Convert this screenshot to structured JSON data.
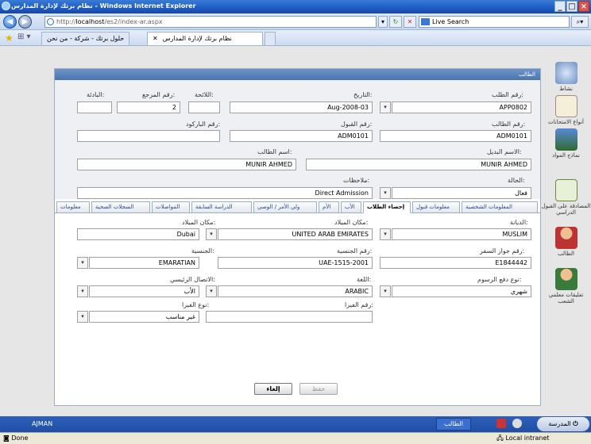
{
  "window": {
    "title": "نظام برتك لإدارة المدارس - Windows Internet Explorer",
    "min": "_",
    "max": "□",
    "close": "×"
  },
  "address": {
    "url_prefix": "http://",
    "url_host": "localhost",
    "url_path": "/es2/index-ar.aspx",
    "search_placeholder": "Live Search"
  },
  "tabs": {
    "tab1": "حلول برتك - شركة - من نحن",
    "tab2": "نظام برتك لإدارة المدارس"
  },
  "sidebar": {
    "items": [
      {
        "label": "نشاط"
      },
      {
        "label": "أنواع الامتحانات"
      },
      {
        "label": "نماذج المواد"
      },
      {
        "label": "المصادقة على القبول الدراسي"
      },
      {
        "label": "الطالب"
      },
      {
        "label": "تعليقات معلمي الشعب"
      }
    ]
  },
  "panel": {
    "header": "الطالب"
  },
  "form": {
    "request_no_label": "رقم الطلب:",
    "request_no": "APP0802",
    "date_label": "التاريخ:",
    "date": "Aug-2008-03",
    "regulation_label": "اللائحة:",
    "regulation": "",
    "ref_no_label": "رقم المرجع:",
    "ref_no": "2",
    "prefix_label": "البادئة:",
    "prefix": "",
    "student_no_label": "رقم الطالب:",
    "student_no": "ADM0101",
    "admission_no_label": "رقم القبول:",
    "admission_no": "ADM0101",
    "barcode_label": "رقم الباركود:",
    "barcode": "",
    "alt_name_label": "الاسم البديل:",
    "alt_name": "MUNIR AHMED",
    "student_name_label": "اسم الطالب:",
    "student_name": "MUNIR AHMED",
    "status_label": "الحالة:",
    "status": "فعال",
    "notes_label": "ملاحظات:",
    "notes": "Direct Admission"
  },
  "formtabs": [
    "المعلومات الشخصية",
    "معلومات قبول",
    "إحصاء الطلاب",
    "الأب",
    "الأم",
    "ولي الأمر / الوصي",
    "الدراسة السابقة",
    "المواصلات",
    "السجلات الصحية",
    "معلومات"
  ],
  "stats": {
    "religion_label": "الديانة:",
    "religion": "MUSLIM",
    "birth_place_label": "مكان الميلاد:",
    "birth_place": "UNITED ARAB EMIRATES",
    "birth_city_label": "مكان الميلاد:",
    "birth_city": "Dubai",
    "passport_label": "رقم جواز السفر:",
    "passport": "E1844442",
    "nationality_no_label": "رقم الجنسية:",
    "nationality_no": "UAE-1515-2001",
    "nationality_label": "الجنسية:",
    "nationality": "EMARATIAN",
    "fees_type_label": "نوع دفع الرسوم:",
    "fees_type": "شهري",
    "language_label": "اللغة:",
    "language": "ARABIC",
    "main_contact_label": "الاتصال الرئيسي:",
    "main_contact": "الأب",
    "visa_no_label": "رقم الفيزا:",
    "visa_no": "",
    "visa_type_label": "نوع الفيزا:",
    "visa_type": "غير مناسب"
  },
  "buttons": {
    "cancel": "إلغاء",
    "save": "حفظ"
  },
  "taskbar": {
    "left": "AJMAN",
    "task": "الطالب",
    "start": "المدرسة"
  },
  "status": {
    "done": "Done",
    "zone": "Local intranet"
  }
}
